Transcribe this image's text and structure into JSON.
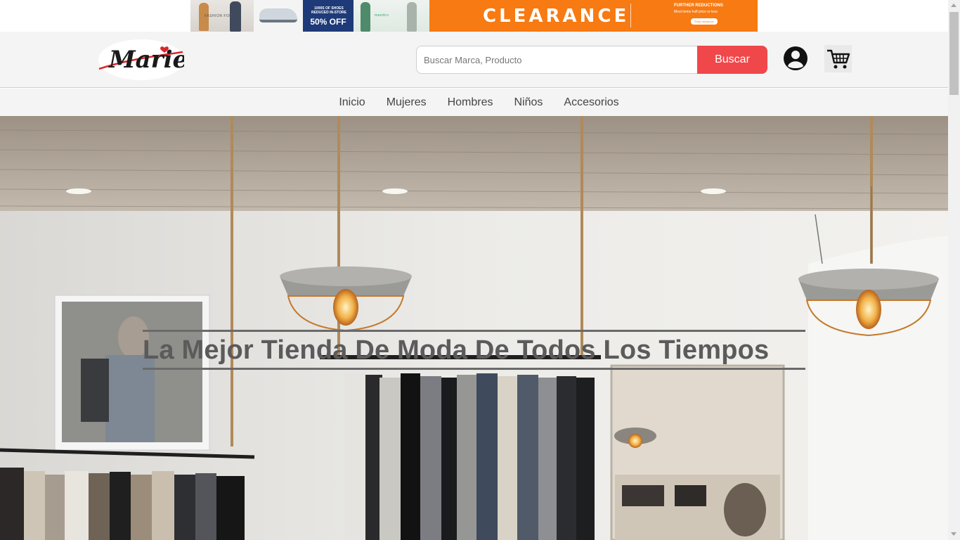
{
  "promo_banner": {
    "fashion_tag": "FASHION FOR",
    "shoes_text": "1000S OF SHOES REDUCED IN-STORE",
    "shoes_discount": "50% OFF",
    "brand_label": "mandco",
    "headline": "CLEARANCE",
    "further_title": "FURTHER REDUCTIONS",
    "further_sub": "Most items half price or less",
    "shop_cta": "Shop clearance",
    "accent_color": "#f77a12"
  },
  "header": {
    "logo_text": "Marie",
    "search": {
      "placeholder": "Buscar Marca, Producto",
      "value": "",
      "button_label": "Buscar",
      "button_color": "#f0474a"
    },
    "icons": {
      "account": "user-circle-icon",
      "cart": "shopping-cart-icon"
    }
  },
  "nav": {
    "items": [
      {
        "label": "Inicio"
      },
      {
        "label": "Mujeres"
      },
      {
        "label": "Hombres"
      },
      {
        "label": "Niños"
      },
      {
        "label": "Accesorios"
      }
    ]
  },
  "hero": {
    "title": "La Mejor Tienda De Moda De Todos Los Tiempos",
    "image": "clothing-store-interior"
  }
}
